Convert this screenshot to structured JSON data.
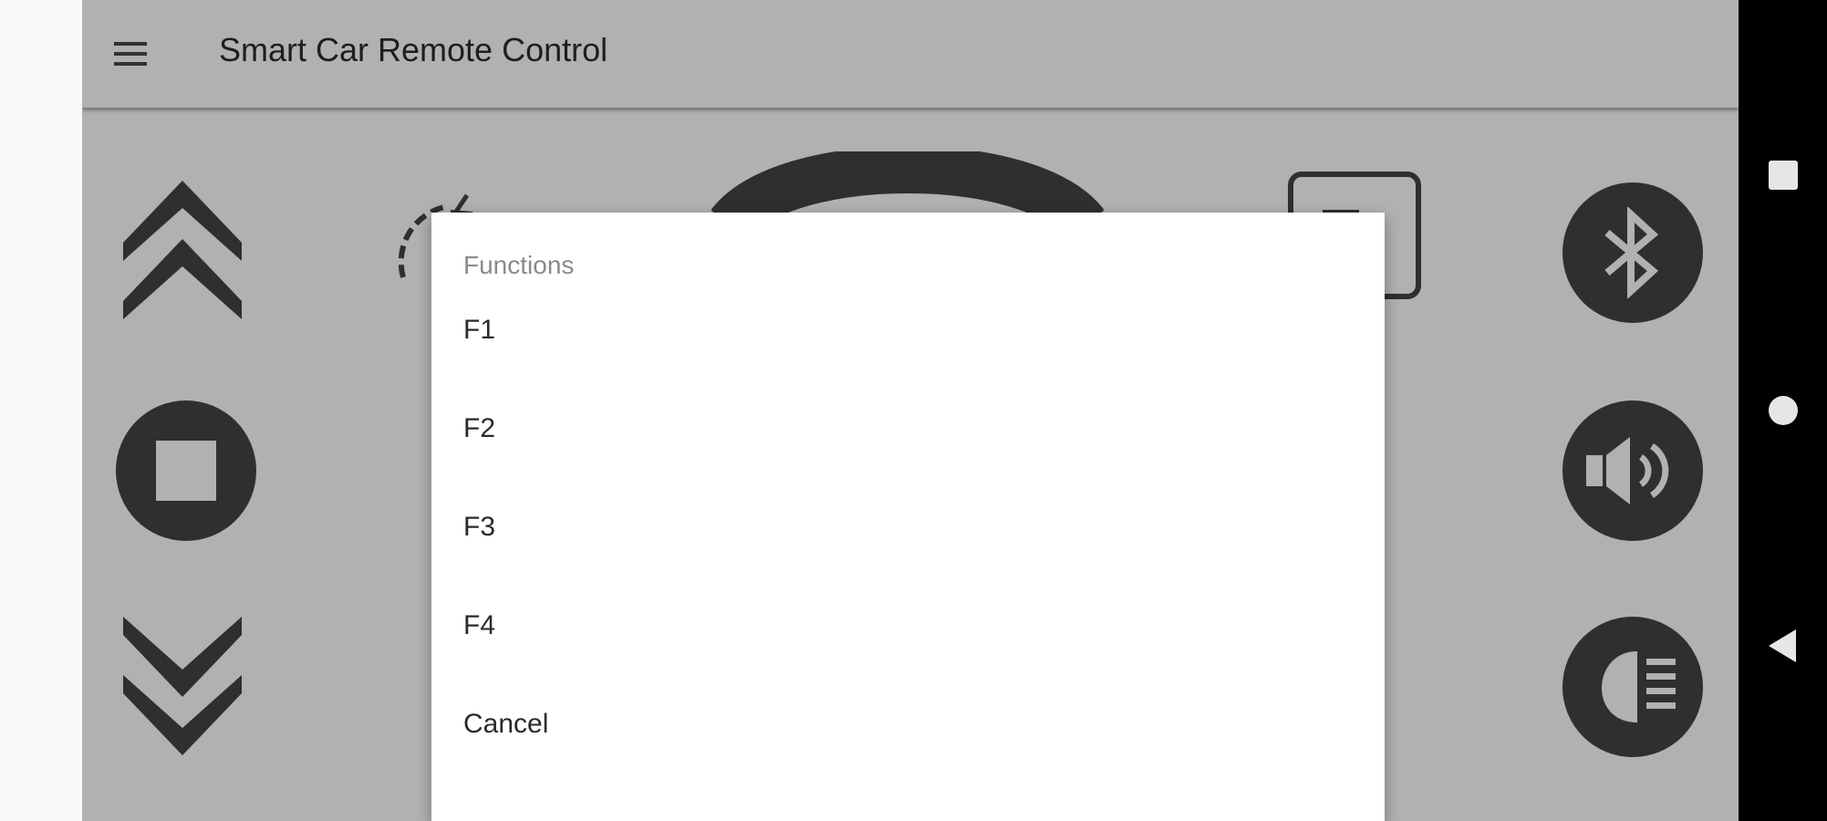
{
  "app": {
    "title": "Smart Car Remote Control",
    "menu_icon": "hamburger-menu-icon"
  },
  "controls": {
    "forward_icon": "double-chevron-up-icon",
    "stop_icon": "stop-square-icon",
    "backward_icon": "double-chevron-down-icon",
    "speed_gauge_icon": "speedometer-gauge-icon",
    "steering_icon": "steering-wheel-icon",
    "function_box_icon": "function-box-icon",
    "bluetooth_icon": "bluetooth-icon",
    "horn_icon": "speaker-volume-icon",
    "headlight_icon": "headlight-icon"
  },
  "dialog": {
    "title": "Functions",
    "items": [
      "F1",
      "F2",
      "F3",
      "F4",
      "Cancel"
    ]
  },
  "system_nav": {
    "recents_icon": "square-recents-icon",
    "home_icon": "circle-home-icon",
    "back_icon": "triangle-back-icon"
  },
  "colors": {
    "scrim_background": "#b1b1b1",
    "control_dark": "#2f2f2f",
    "dialog_background": "#ffffff",
    "nav_bar": "#000000"
  }
}
